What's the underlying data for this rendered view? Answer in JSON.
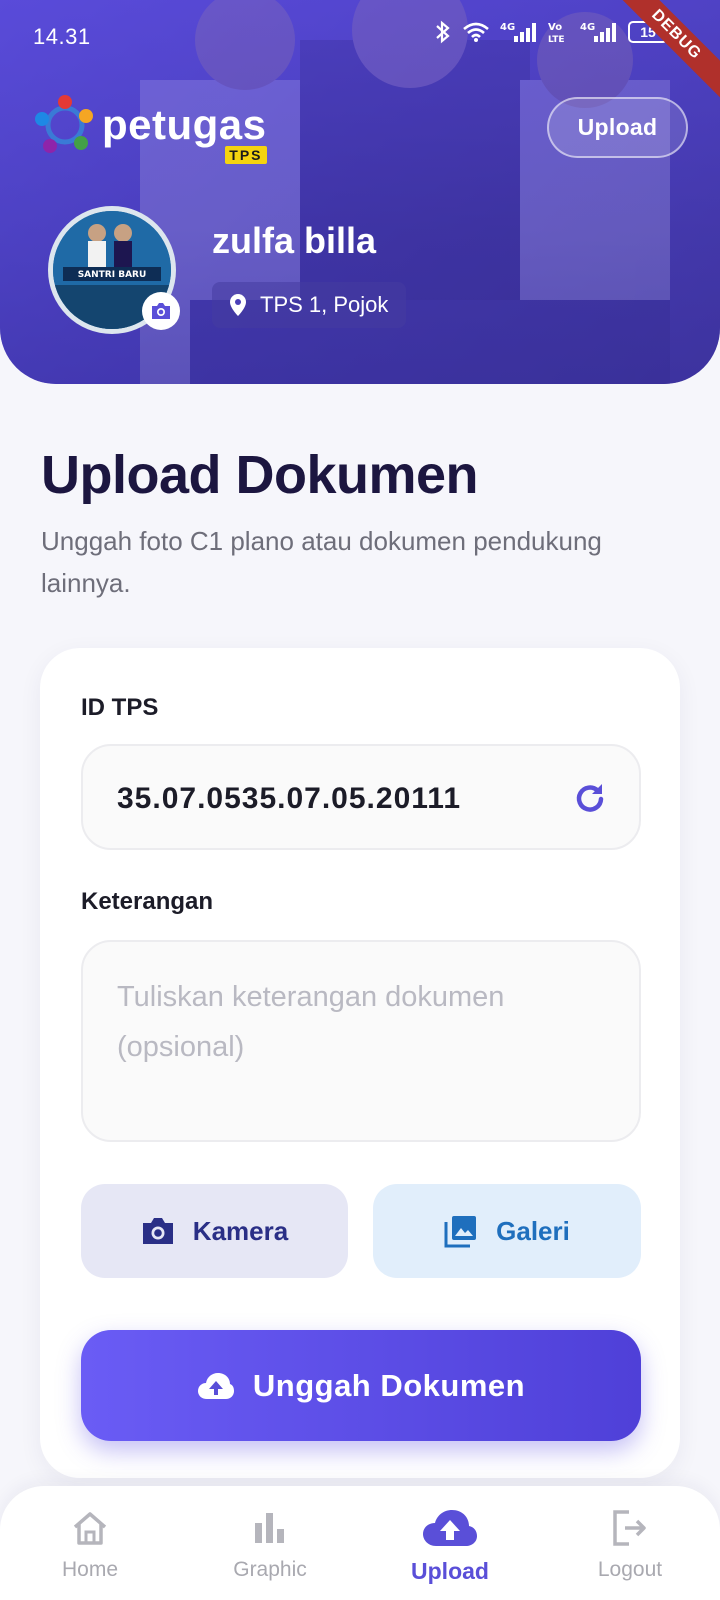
{
  "status_bar": {
    "time": "14.31",
    "battery": "15",
    "debug_label": "DEBUG"
  },
  "header": {
    "logo_word": "petugas",
    "logo_badge": "TPS",
    "upload_button": "Upload",
    "user_name": "zulfa billa",
    "location": "TPS 1, Pojok"
  },
  "main": {
    "title": "Upload Dokumen",
    "subtitle": "Unggah foto C1 plano atau dokumen pendukung lainnya."
  },
  "form": {
    "id_label": "ID TPS",
    "id_value": "35.07.0535.07.05.20111",
    "notes_label": "Keterangan",
    "notes_placeholder": "Tuliskan keterangan dokumen (opsional)",
    "notes_value": "",
    "camera_button": "Kamera",
    "gallery_button": "Galeri",
    "submit_button": "Unggah Dokumen"
  },
  "bottom_nav": {
    "items": [
      {
        "label": "Home",
        "icon": "home-icon",
        "active": false
      },
      {
        "label": "Graphic",
        "icon": "bar-chart-icon",
        "active": false
      },
      {
        "label": "Upload",
        "icon": "cloud-upload-icon",
        "active": true
      },
      {
        "label": "Logout",
        "icon": "logout-icon",
        "active": false
      }
    ]
  },
  "colors": {
    "accent": "#5a4fd8",
    "header_gradient_start": "#5b4fd6",
    "header_gradient_end": "#3d338f",
    "camera_button_bg": "#e6e7f5",
    "gallery_button_bg": "#e1eefb",
    "title_color": "#1c1640"
  }
}
